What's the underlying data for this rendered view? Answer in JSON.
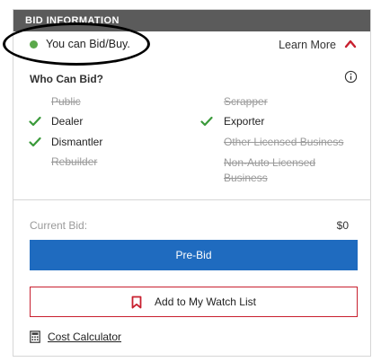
{
  "header": {
    "title": "BID INFORMATION"
  },
  "status": {
    "text": "You can Bid/Buy.",
    "dot_color": "#5aa84a",
    "learn_more": "Learn More",
    "chevron_icon": "chevron-up-icon"
  },
  "who_can_bid": {
    "title": "Who Can Bid?",
    "info_icon": "info-icon",
    "left": [
      {
        "label": "Public",
        "allowed": false
      },
      {
        "label": "Dealer",
        "allowed": true
      },
      {
        "label": "Dismantler",
        "allowed": true
      },
      {
        "label": "Rebuilder",
        "allowed": false
      }
    ],
    "right": [
      {
        "label": "Scrapper",
        "allowed": false
      },
      {
        "label": "Exporter",
        "allowed": true
      },
      {
        "label": "Other Licensed Business",
        "allowed": false
      },
      {
        "label": "Non-Auto Licensed Business",
        "allowed": false
      }
    ]
  },
  "bid": {
    "label": "Current Bid:",
    "value": "$0"
  },
  "actions": {
    "prebid_label": "Pre-Bid",
    "watch_label": "Add to My Watch List",
    "calc_label": "Cost Calculator"
  },
  "colors": {
    "header_bg": "#5b5b5b",
    "primary": "#1f6bbf",
    "accent_red": "#c8202f",
    "check_green": "#3a9a3a"
  }
}
